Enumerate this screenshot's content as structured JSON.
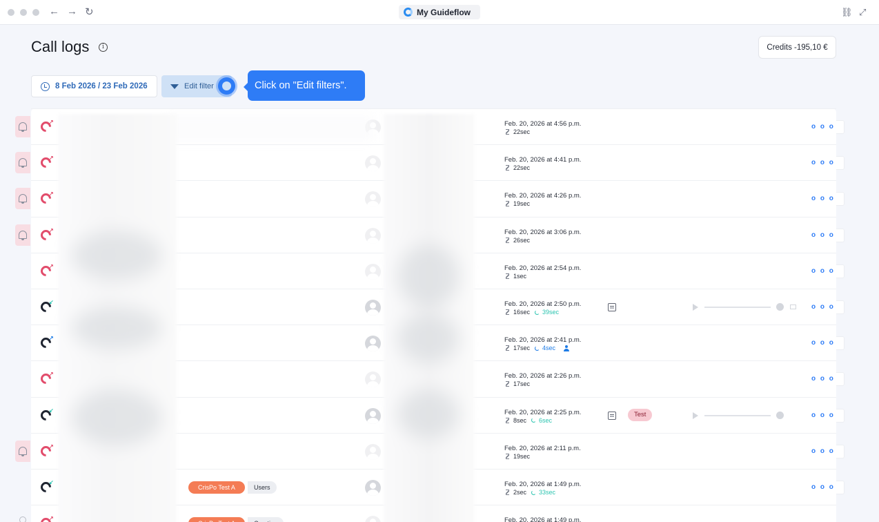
{
  "browser": {
    "tab_title": "My Guideflow",
    "back_icon": "←",
    "forward_icon": "→",
    "reload_icon": "↻",
    "link_icon": "⛓",
    "expand_icon": "⤢"
  },
  "header": {
    "title": "Call logs",
    "info_icon": "i",
    "credits": "Credits -195,10 €"
  },
  "filters": {
    "date_range": "8 Feb 2026 / 23 Feb 2026",
    "edit_filters_label": "Edit filter"
  },
  "guide": {
    "tooltip_text": "Click on \"Edit filters\"."
  },
  "colors": {
    "accent": "#2e7cf6",
    "missed": "#e24c6b",
    "incoming": "#2bc4b0",
    "outgoing": "#1c7be6",
    "tag_bg": "#f7c9d1",
    "chip_orange": "#f47c55"
  },
  "rows": [
    {
      "type": "missed",
      "bell": true,
      "date": "Feb. 20, 2026 at 4:56 p.m.",
      "duration": "22sec",
      "talk": "",
      "more": "o o o"
    },
    {
      "type": "missed",
      "bell": true,
      "date": "Feb. 20, 2026 at 4:41 p.m.",
      "duration": "22sec",
      "talk": "",
      "more": "o o o"
    },
    {
      "type": "missed",
      "bell": true,
      "date": "Feb. 20, 2026 at 4:26 p.m.",
      "duration": "19sec",
      "talk": "",
      "more": "o o o"
    },
    {
      "type": "missed",
      "bell": true,
      "date": "Feb. 20, 2026 at 3:06 p.m.",
      "duration": "26sec",
      "talk": "",
      "more": "o o o"
    },
    {
      "type": "missed",
      "bell": false,
      "date": "Feb. 20, 2026 at 2:54 p.m.",
      "duration": "1sec",
      "talk": "",
      "more": "o o o"
    },
    {
      "type": "incoming",
      "bell": false,
      "date": "Feb. 20, 2026 at 2:50 p.m.",
      "duration": "16sec",
      "talk": "39sec",
      "more": "o o o"
    },
    {
      "type": "outgoing",
      "bell": false,
      "date": "Feb. 20, 2026 at 2:41 p.m.",
      "duration": "17sec",
      "talk": "4sec",
      "more": "o o o"
    },
    {
      "type": "missed",
      "bell": false,
      "date": "Feb. 20, 2026 at 2:26 p.m.",
      "duration": "17sec",
      "talk": "",
      "more": "o o o"
    },
    {
      "type": "incoming",
      "bell": false,
      "date": "Feb. 20, 2026 at 2:25 p.m.",
      "duration": "8sec",
      "talk": "6sec",
      "tag": "Test",
      "more": "o o o"
    },
    {
      "type": "missed",
      "bell": true,
      "date": "Feb. 20, 2026 at 2:11 p.m.",
      "duration": "19sec",
      "talk": "",
      "more": "o o o"
    },
    {
      "type": "incoming",
      "bell": false,
      "date": "Feb. 20, 2026 at 1:49 p.m.",
      "duration": "2sec",
      "talk": "33sec",
      "chip": "CrisPo Test A",
      "chip_suffix": "Users",
      "more": "o o o"
    },
    {
      "type": "missed",
      "bell": false,
      "date": "Feb. 20, 2026 at 1:49 p.m.",
      "duration": "",
      "talk": "",
      "chip": "CrisPo Test A",
      "chip_suffix": "Creating",
      "more": ""
    }
  ]
}
